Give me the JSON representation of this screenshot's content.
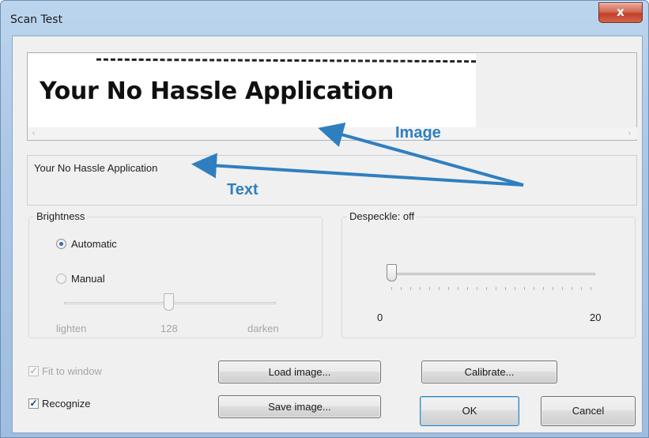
{
  "window": {
    "title": "Scan Test",
    "close_symbol": "x"
  },
  "image_preview": {
    "scanned_text": "Your No Hassle Application",
    "scroll_left": "‹",
    "scroll_right": "›"
  },
  "ocr_result": {
    "text": "Your No Hassle Application"
  },
  "brightness": {
    "label": "Brightness",
    "options": [
      {
        "label": "Automatic",
        "selected": true
      },
      {
        "label": "Manual",
        "selected": false
      }
    ],
    "slider": {
      "value": 128,
      "min_label": "lighten",
      "value_label": "128",
      "max_label": "darken",
      "enabled": false
    }
  },
  "despeckle": {
    "label": "Despeckle: off",
    "slider": {
      "value": 0,
      "min": 0,
      "max": 20,
      "min_label": "0",
      "max_label": "20"
    }
  },
  "options": {
    "fit_to_window": {
      "label": "Fit to window",
      "checked": true,
      "enabled": false
    },
    "recognize": {
      "label": "Recognize",
      "checked": true,
      "enabled": true
    }
  },
  "buttons": {
    "load_image": "Load image...",
    "save_image": "Save image...",
    "calibrate": "Calibrate...",
    "ok": "OK",
    "cancel": "Cancel"
  },
  "annotations": {
    "image_label": "Image",
    "text_label": "Text",
    "color": "#2f7fc0"
  },
  "colors": {
    "titlebar": "#a9c6e6",
    "close_button": "#c2412a",
    "dialog_bg": "#f0f0f0"
  }
}
